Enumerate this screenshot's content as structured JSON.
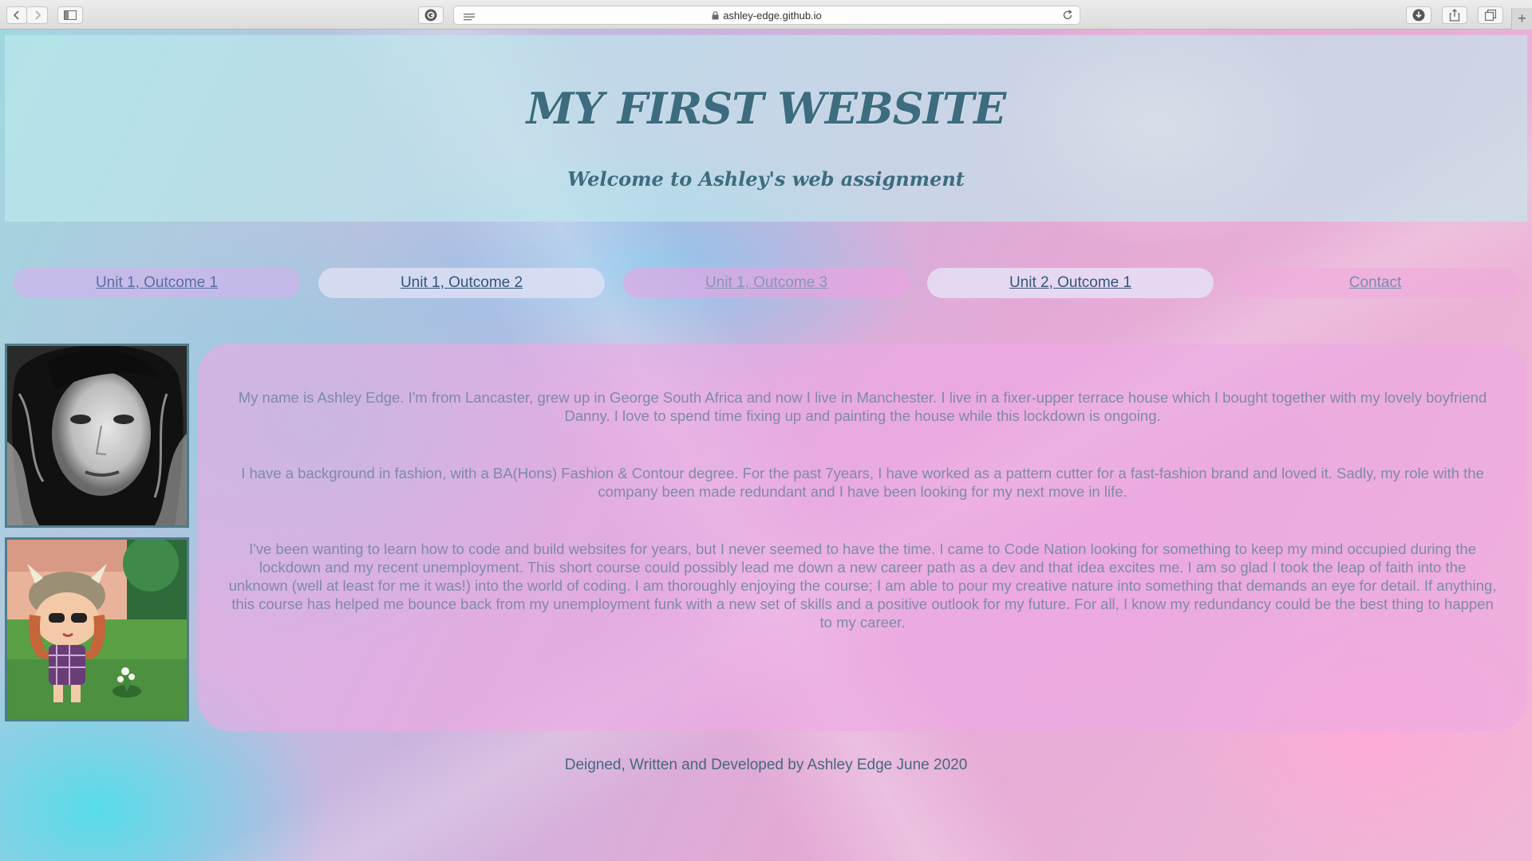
{
  "browser": {
    "url": "ashley-edge.github.io"
  },
  "header": {
    "title": "MY FIRST WEBSITE",
    "subtitle": "Welcome to Ashley's web assignment"
  },
  "nav": {
    "items": [
      {
        "label": "Unit 1, Outcome 1"
      },
      {
        "label": "Unit 1, Outcome 2"
      },
      {
        "label": "Unit 1, Outcome 3"
      },
      {
        "label": "Unit 2, Outcome 1"
      },
      {
        "label": "Contact"
      }
    ]
  },
  "content": {
    "paragraphs": [
      "My name is Ashley Edge. I'm from Lancaster, grew up in George South Africa and now I live in Manchester. I live in a fixer-upper terrace house which I bought together with my lovely boyfriend Danny. I love to spend time fixing up and painting the house while this lockdown is ongoing.",
      "I have a background in fashion, with a BA(Hons) Fashion & Contour degree. For the past 7years, I have worked as a pattern cutter for a fast-fashion brand and loved it. Sadly, my role with the company been made redundant and I have been looking for my next move in life.",
      "I've been wanting to learn how to code and build websites for years, but I never seemed to have the time. I came to Code Nation looking for something to keep my mind occupied during the lockdown and my recent unemployment. This short course could possibly lead me down a new career path as a dev and that idea excites me. I am so glad I took the leap of faith into the unknown (well at least for me it was!) into the world of coding. I am thoroughly enjoying the course; I am able to pour my creative nature into something that demands an eye for detail. If anything, this course has helped me bounce back from my unemployment funk with a new set of skills and a positive outlook for my future. For all, I know my redundancy could be the best thing to happen to my career."
    ]
  },
  "footer": {
    "text": "Deigned, Written and Developed by Ashley Edge June 2020"
  }
}
